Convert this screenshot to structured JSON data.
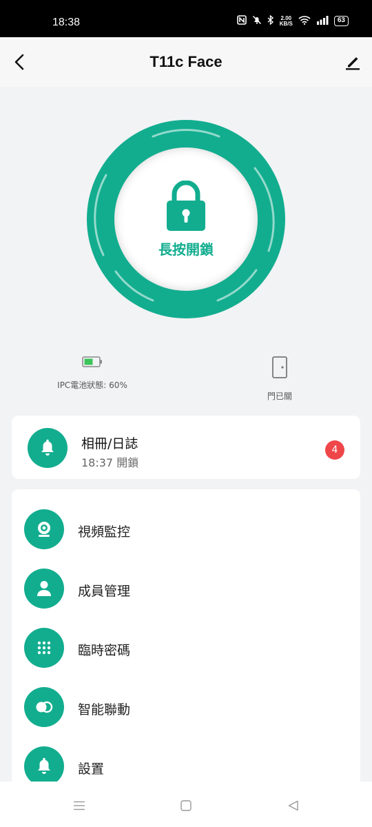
{
  "status_bar": {
    "time": "18:38",
    "speed_value": "2.00",
    "speed_unit": "KB/S",
    "battery": "63"
  },
  "nav": {
    "title": "T11c Face"
  },
  "lock": {
    "label": "長按開鎖"
  },
  "status": {
    "ipc_battery_label": "IPC電池狀態: 60%",
    "ipc_battery_level": 0.6,
    "door_label": "門已關"
  },
  "album": {
    "title": "相冊/日誌",
    "subtitle": "18:37 開鎖",
    "badge": "4"
  },
  "menu": {
    "items": [
      {
        "label": "視頻監控",
        "icon": "camera-icon"
      },
      {
        "label": "成員管理",
        "icon": "person-icon"
      },
      {
        "label": "臨時密碼",
        "icon": "keypad-icon"
      },
      {
        "label": "智能聯動",
        "icon": "toggle-icon"
      },
      {
        "label": "設置",
        "icon": "bell-icon"
      }
    ]
  },
  "colors": {
    "accent": "#12ad8f",
    "badge": "#ef4649",
    "background": "#f2f3f5"
  }
}
